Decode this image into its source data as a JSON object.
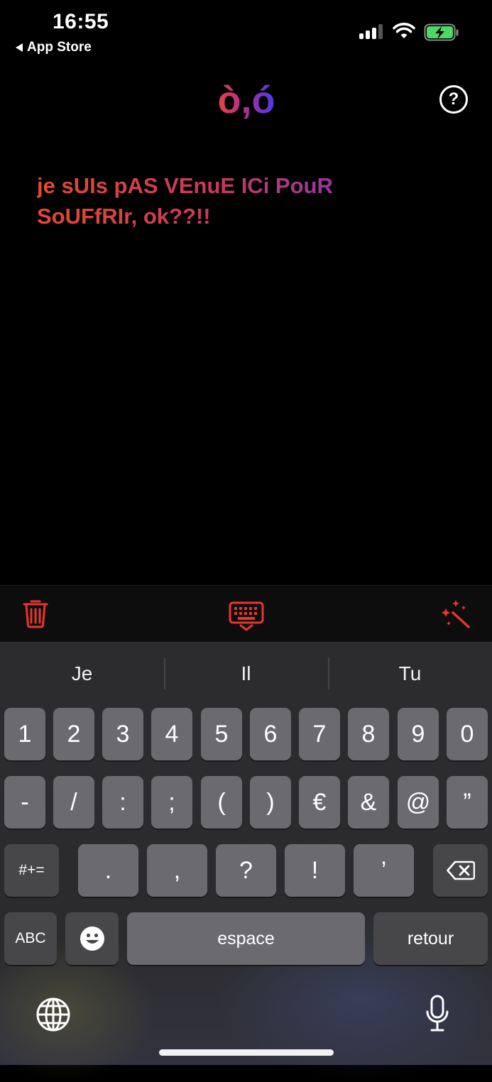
{
  "status": {
    "time": "16:55",
    "back_label": "App Store"
  },
  "header": {
    "title": "ò,ó",
    "help_label": "?"
  },
  "text_output": "je sUIs pAS VEnuE ICi PouR SoUFfRIr, ok??!!",
  "keyboard": {
    "suggestions": [
      "Je",
      "Il",
      "Tu"
    ],
    "row1": [
      "1",
      "2",
      "3",
      "4",
      "5",
      "6",
      "7",
      "8",
      "9",
      "0"
    ],
    "row2": [
      "-",
      "/",
      ":",
      ";",
      "(",
      ")",
      "€",
      "&",
      "@",
      "”"
    ],
    "row3": {
      "shift": "#+=",
      "keys": [
        ".",
        ",",
        "?",
        "!",
        "’"
      ]
    },
    "row4": {
      "abc": "ABC",
      "space": "espace",
      "return": "retour"
    }
  },
  "icons": {
    "toolbar": [
      "trash-icon",
      "keyboard-icon",
      "magic-wand-icon"
    ],
    "accent_color": "#e8362a"
  }
}
